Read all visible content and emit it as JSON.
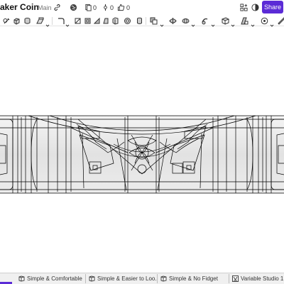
{
  "header": {
    "title": "aker Coin",
    "workspace": "Main",
    "versions_count": "0",
    "branches_count": "0",
    "likes_count": "0",
    "share_label": "Share"
  },
  "colors": {
    "accent": "#5b2bd6",
    "model_line": "#000000",
    "model_fill": "#e7e7e7"
  },
  "toolbar": {
    "icons": [
      "sketch-icon",
      "extrude-icon",
      "revolve-icon",
      "sweep-icon",
      "plane-icon",
      "fillet-icon",
      "chamfer-icon",
      "shell-icon",
      "draft-icon",
      "rib-icon",
      "hole-icon",
      "thicken-icon",
      "boolean-icon",
      "split-icon",
      "transform-icon",
      "pattern-icon",
      "mirror-icon",
      "mate-icon",
      "variable-icon",
      "measure-icon"
    ]
  },
  "tabs": [
    {
      "label": "Simple & Comfortable",
      "icon": "part-studio-icon"
    },
    {
      "label": "Simple & Easier to Loo...",
      "icon": "part-studio-icon"
    },
    {
      "label": "Simple & No Fidget",
      "icon": "part-studio-icon"
    },
    {
      "label": "Variable Studio 1",
      "icon": "variable-studio-icon"
    }
  ]
}
